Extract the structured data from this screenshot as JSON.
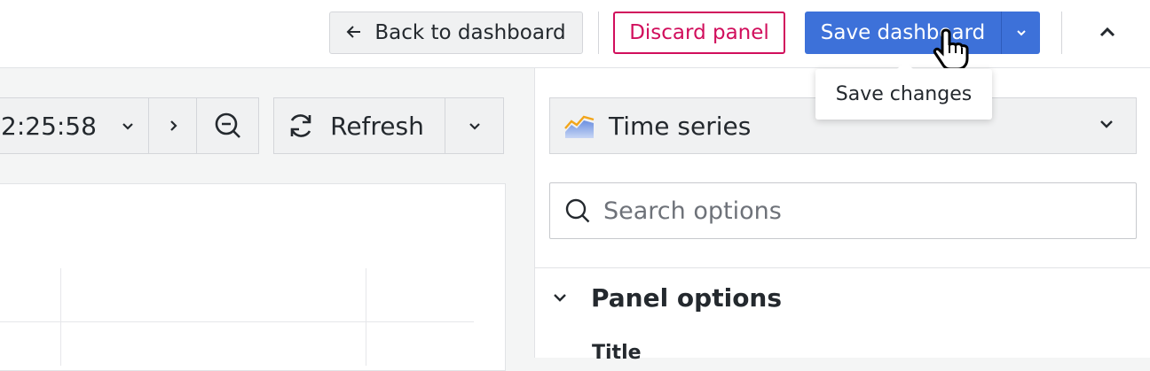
{
  "toolbar": {
    "back_label": "Back to dashboard",
    "discard_label": "Discard panel",
    "save_label": "Save dashboard",
    "tooltip": "Save changes"
  },
  "time_controls": {
    "time_range_fragment": "2:25:58",
    "refresh_label": "Refresh"
  },
  "options_pane": {
    "visualization": "Time series",
    "search_placeholder": "Search options",
    "section_title": "Panel options",
    "field_title_label": "Title"
  },
  "colors": {
    "primary": "#3d71d9",
    "destructive": "#d10e5c"
  }
}
